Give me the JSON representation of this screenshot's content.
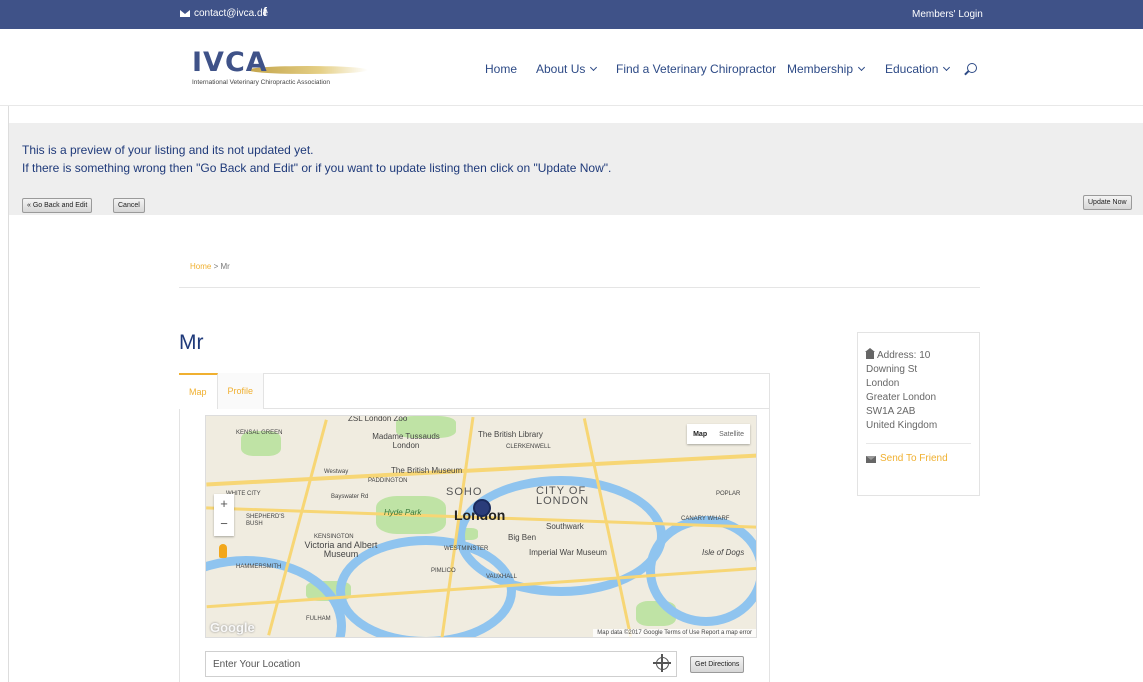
{
  "topbar": {
    "email": "contact@ivca.de",
    "facebook": "f",
    "members_login": "Members' Login"
  },
  "logo": {
    "letters": "IVCA",
    "tagline": "International Veterinary Chiropractic Association"
  },
  "nav": {
    "home": "Home",
    "about": "About Us",
    "find": "Find a Veterinary Chiropractor",
    "membership": "Membership",
    "education": "Education"
  },
  "banner": {
    "line1": "This is a preview of your listing and its not updated yet.",
    "line2": "If there is something wrong then \"Go Back and Edit\" or if you want to update listing then click on \"Update Now\".",
    "go_back": "« Go Back and Edit",
    "cancel": "Cancel",
    "update": "Update Now"
  },
  "breadcrumb": {
    "home": "Home",
    "sep": " > ",
    "current": "Mr"
  },
  "listing": {
    "title": "Mr",
    "tabs": [
      "Map",
      "Profile"
    ]
  },
  "map": {
    "type_map": "Map",
    "type_satellite": "Satellite",
    "zoom_in": "+",
    "zoom_out": "−",
    "labels": {
      "zoo": "ZSL London Zoo",
      "kensal": "KENSAL GREEN",
      "tussauds": "Madame Tussauds London",
      "library": "The British Library",
      "clerkenwell": "CLERKENWELL",
      "museum": "The British Museum",
      "paddington": "PADDINGTON",
      "westway": "Westway",
      "soho": "SOHO",
      "city": "CITY OF LONDON",
      "white_city": "WHITE CITY",
      "bayswater": "Bayswater Rd",
      "poplar": "POPLAR",
      "hyde": "Hyde Park",
      "london": "London",
      "shepherds": "SHEPHERD'S BUSH",
      "canary": "CANARY WHARF",
      "kensington": "KENSINGTON",
      "va": "Victoria and Albert Museum",
      "bigben": "Big Ben",
      "southwark": "Southwark",
      "westminster": "WESTMINSTER",
      "war": "Imperial War Museum",
      "dogs": "Isle of Dogs",
      "hammersmith": "HAMMERSMITH",
      "pimlico": "PIMLICO",
      "fulham": "FULHAM",
      "vauxhall": "VAUXHALL"
    },
    "google": "Google",
    "attribution": "Map data ©2017 Google   Terms of Use   Report a map error"
  },
  "location": {
    "placeholder": "Enter Your Location",
    "directions": "Get Directions"
  },
  "address": {
    "label": "Address: 10",
    "lines": [
      "Downing St",
      "London",
      "Greater London",
      "SW1A 2AB",
      "United Kingdom"
    ],
    "send": "Send To Friend"
  }
}
